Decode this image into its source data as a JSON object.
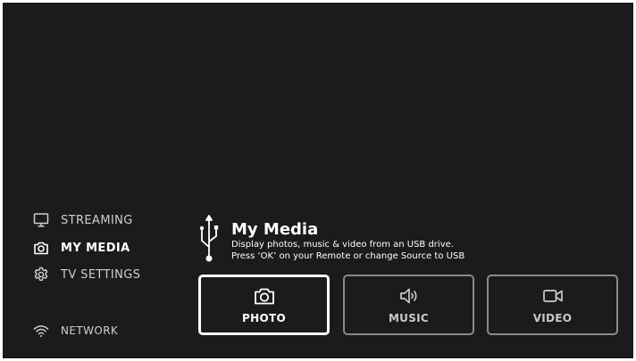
{
  "menu": {
    "items": [
      {
        "label": "STREAMING",
        "icon": "tv-icon"
      },
      {
        "label": "MY MEDIA",
        "icon": "camera-icon",
        "active": true
      },
      {
        "label": "TV SETTINGS",
        "icon": "gear-icon"
      }
    ],
    "network": {
      "label": "NETWORK",
      "icon": "wifi-icon"
    }
  },
  "panel": {
    "icon": "usb-icon",
    "title": "My Media",
    "description_line1": "Display photos, music & video from an USB drive.",
    "description_line2": "Press ‘OK’ on your Remote or change Source to USB"
  },
  "tiles": [
    {
      "label": "PHOTO",
      "icon": "camera-icon",
      "focused": true
    },
    {
      "label": "MUSIC",
      "icon": "speaker-icon",
      "focused": false
    },
    {
      "label": "VIDEO",
      "icon": "video-camera-icon",
      "focused": false
    }
  ],
  "colors": {
    "background": "#1b1b1b",
    "text": "#ffffff",
    "muted_text": "#cfcfcf",
    "tile_border": "#8a8a8a",
    "focus_border": "#ffffff"
  }
}
